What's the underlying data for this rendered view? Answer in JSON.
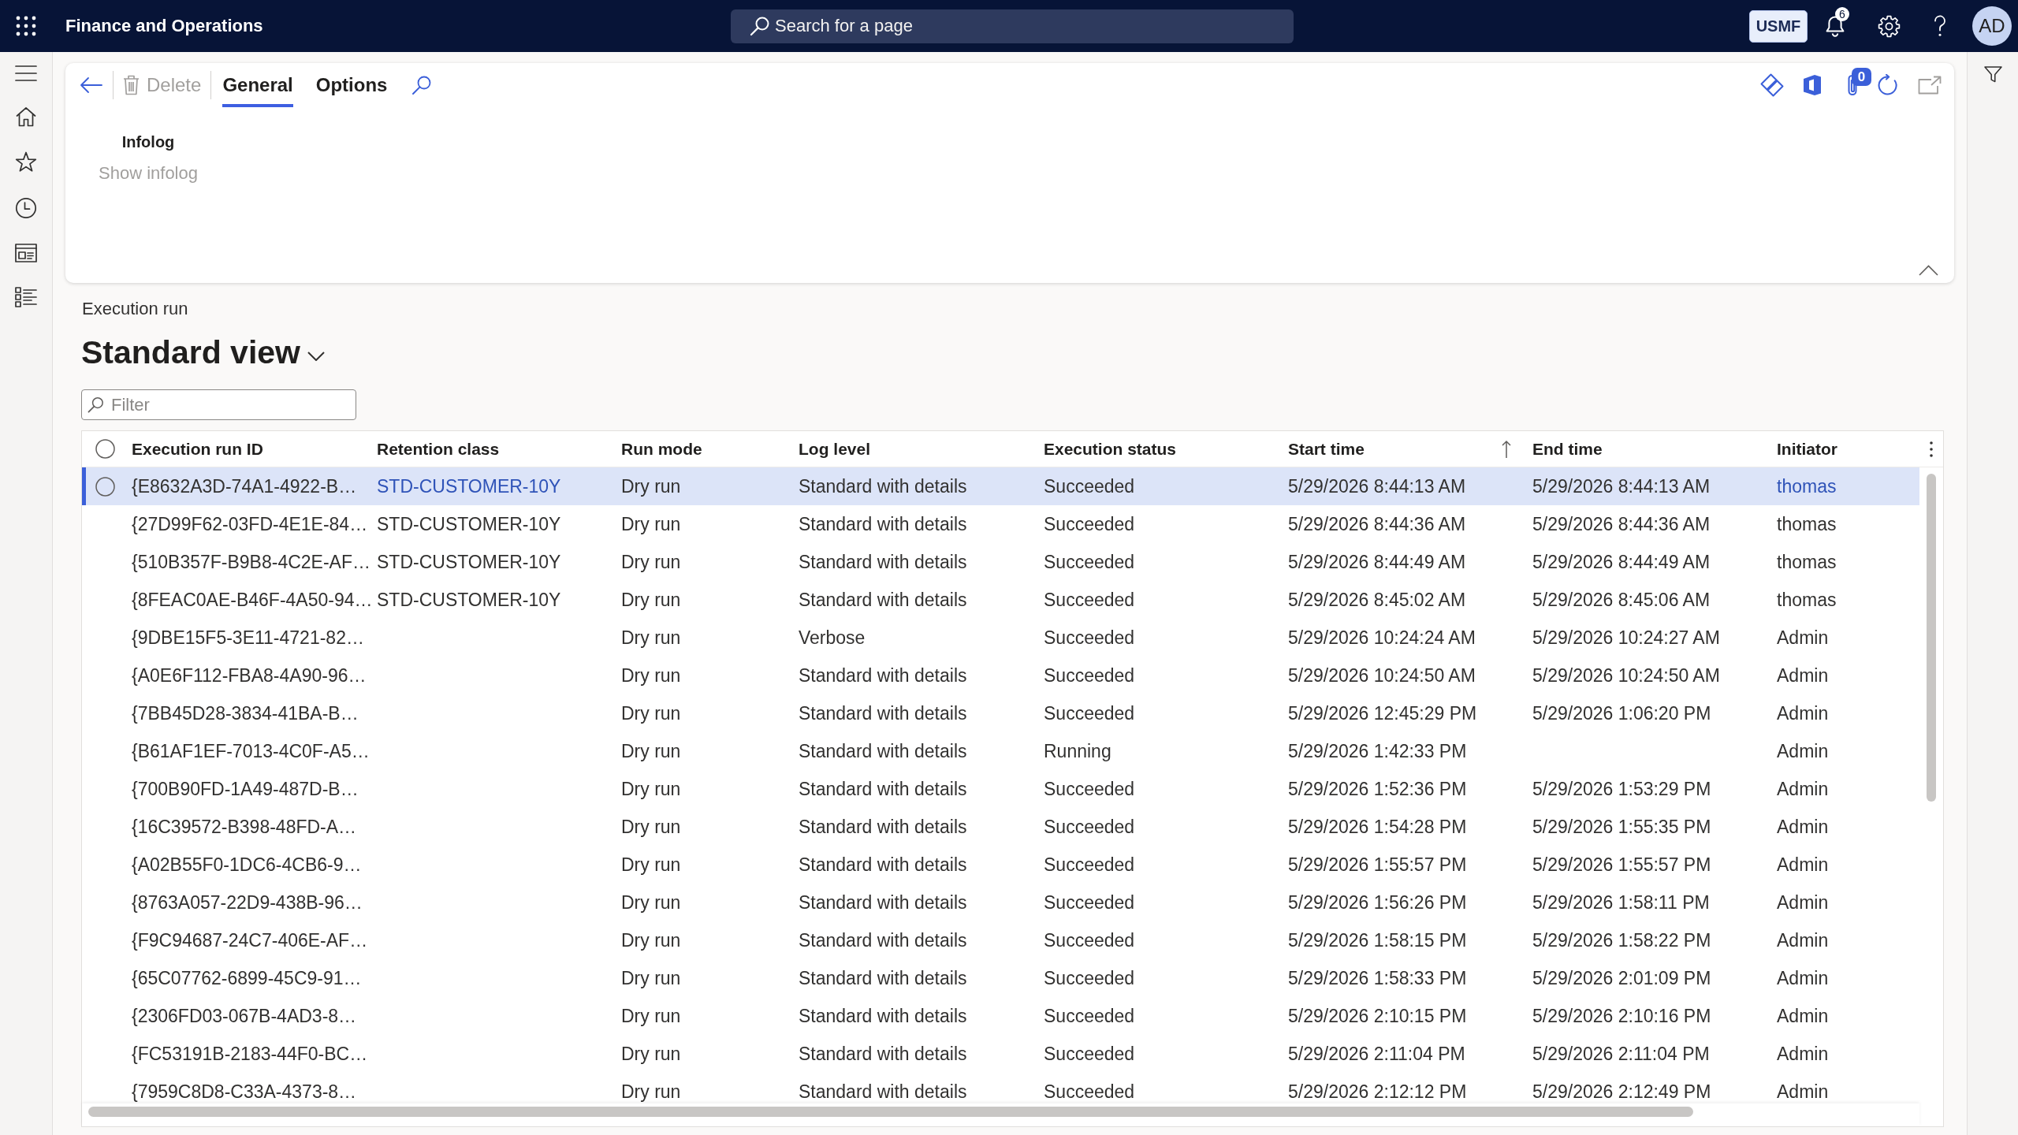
{
  "top_bar": {
    "title": "Finance and Operations",
    "search": {
      "placeholder": "Search for a page"
    },
    "company": "USMF",
    "notification_count": "6",
    "avatar": "AD"
  },
  "action_pane": {
    "delete": {
      "label": "Delete",
      "disabled": true
    },
    "tabs": [
      {
        "label": "General",
        "selected": true
      },
      {
        "label": "Options",
        "selected": false
      }
    ],
    "attachment_count": "0",
    "group": {
      "title": "Infolog",
      "buttons": [
        {
          "label": "Show infolog",
          "disabled": true
        }
      ]
    }
  },
  "page": {
    "caption": "Execution run",
    "view": "Standard view",
    "filter": {
      "placeholder": "Filter"
    }
  },
  "grid": {
    "select_all": {
      "checked": false
    },
    "columns": [
      {
        "label": "Execution run ID",
        "kind": "text",
        "sorted": false
      },
      {
        "label": "Retention class",
        "kind": "link",
        "sorted": false
      },
      {
        "label": "Run mode",
        "kind": "text",
        "sorted": false
      },
      {
        "label": "Log level",
        "kind": "text",
        "sorted": false
      },
      {
        "label": "Execution status",
        "kind": "text",
        "sorted": false
      },
      {
        "label": "Start time",
        "kind": "text",
        "sorted": true
      },
      {
        "label": "End time",
        "kind": "text",
        "sorted": false
      },
      {
        "label": "Initiator",
        "kind": "link",
        "sorted": false
      }
    ],
    "rows": [
      {
        "selected": true,
        "execution_run_id": "{E8632A3D-74A1-4922-B…",
        "retention_class": "STD-CUSTOMER-10Y",
        "run_mode": "Dry run",
        "log_level": "Standard with details",
        "execution_status": "Succeeded",
        "start_time": "5/29/2026 8:44:13 AM",
        "end_time": "5/29/2026 8:44:13 AM",
        "initiator": "thomas"
      },
      {
        "selected": false,
        "execution_run_id": "{27D99F62-03FD-4E1E-84…",
        "retention_class": "STD-CUSTOMER-10Y",
        "run_mode": "Dry run",
        "log_level": "Standard with details",
        "execution_status": "Succeeded",
        "start_time": "5/29/2026 8:44:36 AM",
        "end_time": "5/29/2026 8:44:36 AM",
        "initiator": "thomas"
      },
      {
        "selected": false,
        "execution_run_id": "{510B357F-B9B8-4C2E-AF…",
        "retention_class": "STD-CUSTOMER-10Y",
        "run_mode": "Dry run",
        "log_level": "Standard with details",
        "execution_status": "Succeeded",
        "start_time": "5/29/2026 8:44:49 AM",
        "end_time": "5/29/2026 8:44:49 AM",
        "initiator": "thomas"
      },
      {
        "selected": false,
        "execution_run_id": "{8FEAC0AE-B46F-4A50-94…",
        "retention_class": "STD-CUSTOMER-10Y",
        "run_mode": "Dry run",
        "log_level": "Standard with details",
        "execution_status": "Succeeded",
        "start_time": "5/29/2026 8:45:02 AM",
        "end_time": "5/29/2026 8:45:06 AM",
        "initiator": "thomas"
      },
      {
        "selected": false,
        "execution_run_id": "{9DBE15F5-3E11-4721-82…",
        "run_mode": "Dry run",
        "log_level": "Verbose",
        "execution_status": "Succeeded",
        "start_time": "5/29/2026 10:24:24 AM",
        "end_time": "5/29/2026 10:24:27 AM",
        "initiator": "Admin"
      },
      {
        "selected": false,
        "execution_run_id": "{A0E6F112-FBA8-4A90-96…",
        "run_mode": "Dry run",
        "log_level": "Standard with details",
        "execution_status": "Succeeded",
        "start_time": "5/29/2026 10:24:50 AM",
        "end_time": "5/29/2026 10:24:50 AM",
        "initiator": "Admin"
      },
      {
        "selected": false,
        "execution_run_id": "{7BB45D28-3834-41BA-B…",
        "run_mode": "Dry run",
        "log_level": "Standard with details",
        "execution_status": "Succeeded",
        "start_time": "5/29/2026 12:45:29 PM",
        "end_time": "5/29/2026 1:06:20 PM",
        "initiator": "Admin"
      },
      {
        "selected": false,
        "execution_run_id": "{B61AF1EF-7013-4C0F-A5…",
        "run_mode": "Dry run",
        "log_level": "Standard with details",
        "execution_status": "Running",
        "start_time": "5/29/2026 1:42:33 PM",
        "initiator": "Admin"
      },
      {
        "selected": false,
        "execution_run_id": "{700B90FD-1A49-487D-B…",
        "run_mode": "Dry run",
        "log_level": "Standard with details",
        "execution_status": "Succeeded",
        "start_time": "5/29/2026 1:52:36 PM",
        "end_time": "5/29/2026 1:53:29 PM",
        "initiator": "Admin"
      },
      {
        "selected": false,
        "execution_run_id": "{16C39572-B398-48FD-A…",
        "run_mode": "Dry run",
        "log_level": "Standard with details",
        "execution_status": "Succeeded",
        "start_time": "5/29/2026 1:54:28 PM",
        "end_time": "5/29/2026 1:55:35 PM",
        "initiator": "Admin"
      },
      {
        "selected": false,
        "execution_run_id": "{A02B55F0-1DC6-4CB6-9…",
        "run_mode": "Dry run",
        "log_level": "Standard with details",
        "execution_status": "Succeeded",
        "start_time": "5/29/2026 1:55:57 PM",
        "end_time": "5/29/2026 1:55:57 PM",
        "initiator": "Admin"
      },
      {
        "selected": false,
        "execution_run_id": "{8763A057-22D9-438B-96…",
        "run_mode": "Dry run",
        "log_level": "Standard with details",
        "execution_status": "Succeeded",
        "start_time": "5/29/2026 1:56:26 PM",
        "end_time": "5/29/2026 1:58:11 PM",
        "initiator": "Admin"
      },
      {
        "selected": false,
        "execution_run_id": "{F9C94687-24C7-406E-AF…",
        "run_mode": "Dry run",
        "log_level": "Standard with details",
        "execution_status": "Succeeded",
        "start_time": "5/29/2026 1:58:15 PM",
        "end_time": "5/29/2026 1:58:22 PM",
        "initiator": "Admin"
      },
      {
        "selected": false,
        "execution_run_id": "{65C07762-6899-45C9-91…",
        "run_mode": "Dry run",
        "log_level": "Standard with details",
        "execution_status": "Succeeded",
        "start_time": "5/29/2026 1:58:33 PM",
        "end_time": "5/29/2026 2:01:09 PM",
        "initiator": "Admin"
      },
      {
        "selected": false,
        "execution_run_id": "{2306FD03-067B-4AD3-8…",
        "run_mode": "Dry run",
        "log_level": "Standard with details",
        "execution_status": "Succeeded",
        "start_time": "5/29/2026 2:10:15 PM",
        "end_time": "5/29/2026 2:10:16 PM",
        "initiator": "Admin"
      },
      {
        "selected": false,
        "execution_run_id": "{FC53191B-2183-44F0-BC…",
        "run_mode": "Dry run",
        "log_level": "Standard with details",
        "execution_status": "Succeeded",
        "start_time": "5/29/2026 2:11:04 PM",
        "end_time": "5/29/2026 2:11:04 PM",
        "initiator": "Admin"
      },
      {
        "selected": false,
        "execution_run_id": "{7959C8D8-C33A-4373-8…",
        "run_mode": "Dry run",
        "log_level": "Standard with details",
        "execution_status": "Succeeded",
        "start_time": "5/29/2026 2:12:12 PM",
        "end_time": "5/29/2026 2:12:49 PM",
        "initiator": "Admin"
      }
    ]
  }
}
